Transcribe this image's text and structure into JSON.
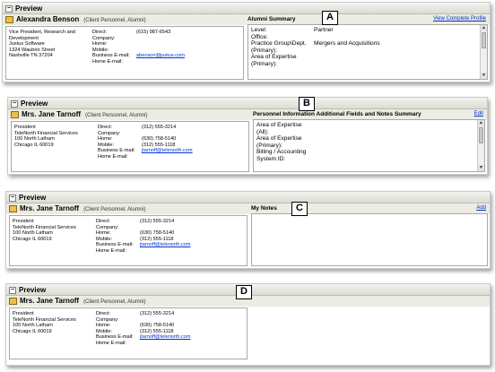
{
  "panels": {
    "a": {
      "label": "A",
      "header": "Preview",
      "name": "Alexandra Benson",
      "type": "(Client Personnel, Alumni)",
      "address": [
        "Vice President, Research and",
        "Development",
        "Justus Software",
        "1324 Waubon Street",
        "Nashville TN 37204"
      ],
      "direct_label": "Direct:",
      "direct": "(615) 987-6543",
      "company_label": "Company:",
      "company": "",
      "home_label": "Home:",
      "home": "",
      "mobile_label": "Mobile:",
      "mobile": "",
      "bemail_label": "Business E-mail:",
      "bemail": "abenson@justus.com",
      "hemail_label": "Home E-mail:",
      "hemail": "",
      "right_title": "Alumni Summary",
      "right_action": "View Complete Profile",
      "fields": [
        {
          "k": "Level:",
          "v": "Partner"
        },
        {
          "k": "Office:",
          "v": ""
        },
        {
          "k": "Practice Group\\Dept.",
          "v": "Mergers and Acquisitions"
        },
        {
          "k": "(Primary):",
          "v": ""
        },
        {
          "k": "Area of Expertise",
          "v": ""
        },
        {
          "k": "(Primary):",
          "v": ""
        }
      ]
    },
    "b": {
      "label": "B",
      "header": "Preview",
      "name": "Mrs. Jane Tarnoff",
      "type": "(Client Personnel, Alumni)",
      "address": [
        "President",
        "TeleNorth Financial Services",
        "100 North Latham",
        "Chicago IL 60019"
      ],
      "direct_label": "Direct:",
      "direct": "(312) 555-3214",
      "company_label": "Company:",
      "company": "",
      "home_label": "Home:",
      "home": "(630) 758-5140",
      "mobile_label": "Mobile:",
      "mobile": "(312) 555-1118",
      "bemail_label": "Business E-mail:",
      "bemail": "jtarnoff@telenorth.com",
      "hemail_label": "Home E-mail:",
      "hemail": "",
      "right_title": "Personnel Information Additional Fields and Notes Summary",
      "right_action": "Edit",
      "fields": [
        "Area of Expertise",
        "(All):",
        "Area of Expertise",
        "(Primary):",
        "Billing / Accounting",
        "System ID:"
      ]
    },
    "c": {
      "label": "C",
      "header": "Preview",
      "name": "Mrs. Jane Tarnoff",
      "type": "(Client Personnel, Alumni)",
      "address": [
        "President",
        "TeleNorth Financial Services",
        "100 North Latham",
        "Chicago IL 60019"
      ],
      "direct_label": "Direct:",
      "direct": "(312) 555-3214",
      "company_label": "Company:",
      "company": "",
      "home_label": "Home:",
      "home": "(630) 758-5140",
      "mobile_label": "Mobile:",
      "mobile": "(312) 555-1118",
      "bemail_label": "Business E-mail:",
      "bemail": "jtarnoff@telenorth.com",
      "hemail_label": "Home E-mail:",
      "hemail": "",
      "right_title": "My Notes",
      "right_action": "Add"
    },
    "d": {
      "label": "D",
      "header": "Preview",
      "name": "Mrs. Jane Tarnoff",
      "type": "(Client Personnel, Alumni)",
      "address": [
        "President",
        "TeleNorth Financial Services",
        "100 North Latham",
        "Chicago IL 60019"
      ],
      "direct_label": "Direct:",
      "direct": "(312) 555-3214",
      "company_label": "Company:",
      "company": "",
      "home_label": "Home:",
      "home": "(630) 758-5140",
      "mobile_label": "Mobile:",
      "mobile": "(312) 555-1118",
      "bemail_label": "Business E-mail:",
      "bemail": "jtarnoff@telenorth.com",
      "hemail_label": "Home E-mail:",
      "hemail": ""
    }
  }
}
